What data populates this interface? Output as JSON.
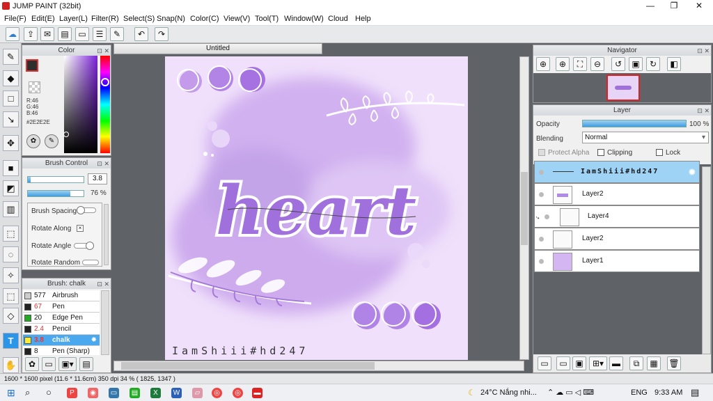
{
  "app": {
    "title": "JUMP PAINT (32bit)"
  },
  "menu": [
    "File(F)",
    "Edit(E)",
    "Layer(L)",
    "Filter(R)",
    "Select(S)",
    "Snap(N)",
    "Color(C)",
    "View(V)",
    "Tool(T)",
    "Window(W)",
    "Cloud",
    "Help"
  ],
  "color_panel": {
    "title": "Color",
    "r": "R:46",
    "g": "G:46",
    "b": "B:46",
    "hex": "#2E2E2E"
  },
  "brush_control": {
    "title": "Brush Control",
    "size": "3.8",
    "density": "76 %",
    "density_fill": 0.76,
    "size_fill": 0.05,
    "spacing": "Brush Spacing",
    "rotate_along": "Rotate Along",
    "rotate_angle": "Rotate Angle",
    "rotate_random": "Rotate Random"
  },
  "brush_list": {
    "title": "Brush: chalk",
    "items": [
      {
        "size": "577",
        "name": "Airbrush",
        "color": "#cccccc",
        "red": false,
        "sel": false
      },
      {
        "size": "67",
        "name": "Pen",
        "color": "#222222",
        "red": true,
        "sel": false
      },
      {
        "size": "20",
        "name": "Edge Pen",
        "color": "#22aa22",
        "red": false,
        "sel": false
      },
      {
        "size": "2.4",
        "name": "Pencil",
        "color": "#222222",
        "red": true,
        "sel": false
      },
      {
        "size": "3.8",
        "name": "chalk",
        "color": "#ffee33",
        "red": true,
        "sel": true
      },
      {
        "size": "8",
        "name": "Pen (Sharp)",
        "color": "#222222",
        "red": false,
        "sel": false
      }
    ]
  },
  "canvas": {
    "tab": "Untitled",
    "art_text": "heart",
    "signature": "IamShiii#hd247"
  },
  "navigator": {
    "title": "Navigator"
  },
  "layer_panel": {
    "title": "Layer",
    "opacity_label": "Opacity",
    "opacity": "100 %",
    "opacity_fill": 1.0,
    "blending_label": "Blending",
    "blending": "Normal",
    "protect_alpha": "Protect Alpha",
    "clipping": "Clipping",
    "lock": "Lock",
    "layers": [
      {
        "name": "IamShiii#hd247",
        "selected": true
      },
      {
        "name": "Layer2",
        "selected": false
      },
      {
        "name": "Layer4",
        "selected": false
      },
      {
        "name": "Layer2",
        "selected": false
      },
      {
        "name": "Layer1",
        "selected": false
      }
    ]
  },
  "status": {
    "text": "1600 * 1600 pixel  (11.6 * 11.6cm)  350 dpi  34 %  ( 1825, 1347 )"
  },
  "taskbar": {
    "weather": "24°C  Nắng nhi...",
    "lang": "ENG",
    "time": "9:33 AM"
  }
}
